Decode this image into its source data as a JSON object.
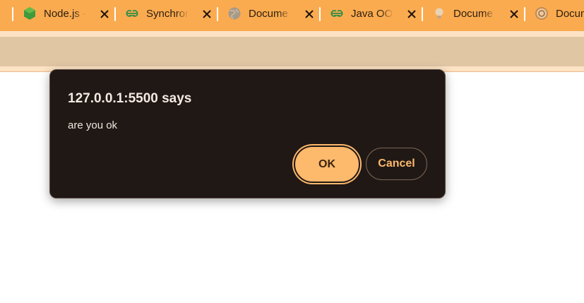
{
  "tabs": [
    {
      "title": "Node.js -",
      "icon": "nodejs-icon"
    },
    {
      "title": "Synchron",
      "icon": "geeksforgeeks-icon"
    },
    {
      "title": "Docume",
      "icon": "globe-icon"
    },
    {
      "title": "Java OO",
      "icon": "geeksforgeeks-icon"
    },
    {
      "title": "Docume",
      "icon": "bulb-icon"
    },
    {
      "title": "Docum",
      "icon": "spinner-icon"
    }
  ],
  "dialog": {
    "title": "127.0.0.1:5500 says",
    "message": "are you ok",
    "ok_label": "OK",
    "cancel_label": "Cancel"
  },
  "colors": {
    "tab_bar": "#fbab4f",
    "toolbar": "#e1c6a4",
    "dialog_bg": "#201815",
    "accent": "#fdb96c"
  }
}
